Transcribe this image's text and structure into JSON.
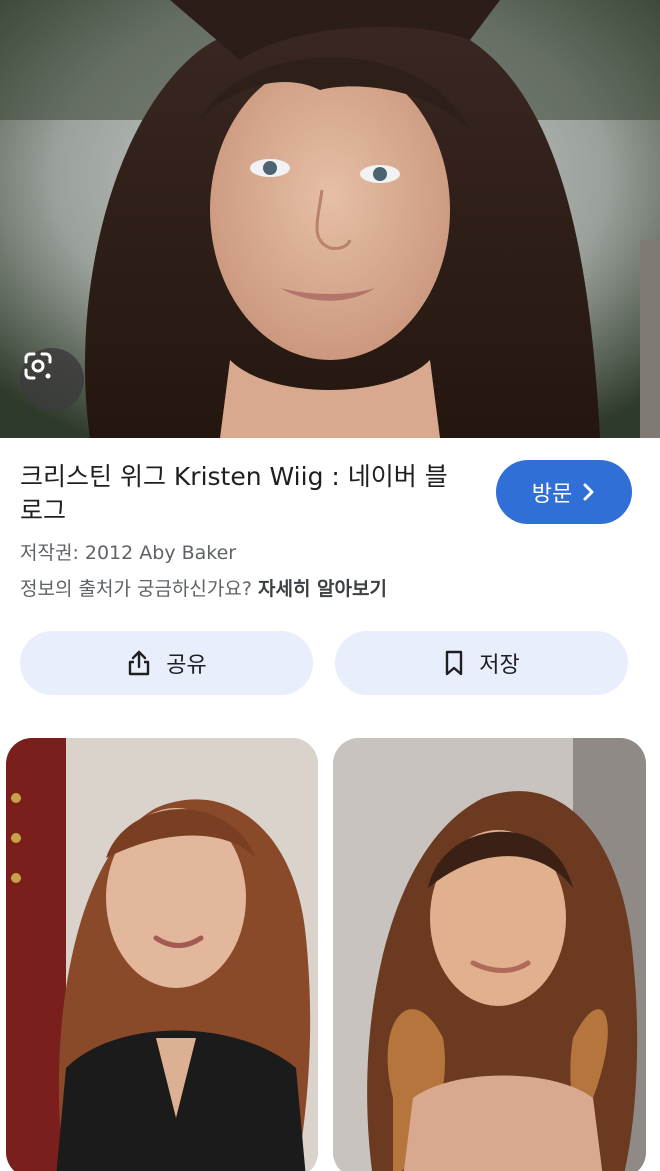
{
  "result": {
    "title": "크리스틴 위그 Kristen Wiig : 네이버 블로그",
    "visit_label": "방문",
    "copyright": "저작권: 2012 Aby Baker",
    "source_question": "정보의 출처가 궁금하신가요?",
    "learn_more": "자세히 알아보기"
  },
  "actions": {
    "share_label": "공유",
    "save_label": "저장"
  },
  "colors": {
    "visit_button": "#2f6fd6",
    "action_button_bg": "#e8eefb"
  },
  "icons": [
    "google-lens-icon",
    "chevron-right-icon",
    "share-icon",
    "bookmark-icon"
  ]
}
